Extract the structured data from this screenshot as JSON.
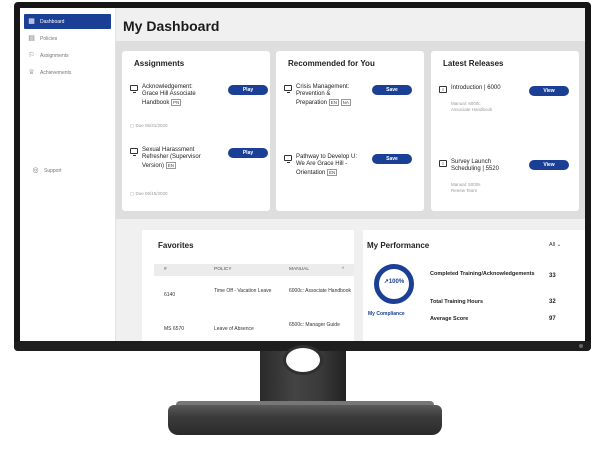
{
  "sidebar": {
    "items": [
      {
        "label": "Dashboard",
        "icon": "dashboard-icon",
        "active": true
      },
      {
        "label": "Policies",
        "icon": "policies-icon"
      },
      {
        "label": "Assignments",
        "icon": "assignments-icon"
      },
      {
        "label": "Achievements",
        "icon": "achievements-icon"
      }
    ],
    "support": "Support"
  },
  "page_title": "My Dashboard",
  "assignments": {
    "title": "Assignments",
    "items": [
      {
        "text": "Acknowledgement: Grace Hill Associate Handbook",
        "badge": "PN",
        "sub": "Due 05/31/2020",
        "button": "Play"
      },
      {
        "text": "Sexual Harassment Refresher (Supervisor Version)",
        "badge": "EN",
        "sub": "Due 06/15/2020",
        "button": "Play"
      }
    ]
  },
  "recommended": {
    "title": "Recommended for You",
    "items": [
      {
        "text": "Crisis Management: Prevention & Preparation",
        "badge": "EN",
        "badge2": "NA",
        "button": "Save"
      },
      {
        "text": "Pathway to Develop U: We Are Grace Hill - Orientation",
        "badge": "EN",
        "button": "Save"
      }
    ]
  },
  "releases": {
    "title": "Latest Releases",
    "items": [
      {
        "text": "Introduction | 6000",
        "sub1": "Manual: 6000c",
        "sub2": "Associate Handbook",
        "button": "View"
      },
      {
        "text": "Survey Launch Scheduling | 5520",
        "sub1": "Manual: 5000s",
        "sub2": "Renew Team",
        "button": "View"
      }
    ]
  },
  "favorites": {
    "title": "Favorites",
    "columns": [
      "#",
      "POLICY",
      "MANUAL"
    ],
    "rows": [
      {
        "id": "6140",
        "policy": "Time Off - Vacation Leave",
        "manual": "6000c: Associate Handbook"
      },
      {
        "id": "MS 6570",
        "policy": "Leave of Absence",
        "manual": "6500c: Manager Guide"
      }
    ]
  },
  "performance": {
    "title": "My Performance",
    "filter": "All",
    "compliance_value": "100%",
    "compliance_fraction": 1.0,
    "compliance_label": "My Compliance",
    "stats": [
      {
        "label": "Completed Training/Acknowledgements",
        "value": "33"
      },
      {
        "label": "Total Training Hours",
        "value": "32"
      },
      {
        "label": "Average Score",
        "value": "97"
      }
    ]
  },
  "colors": {
    "accent": "#1a3f94",
    "panel": "#dedede",
    "bezel": "#161616"
  }
}
